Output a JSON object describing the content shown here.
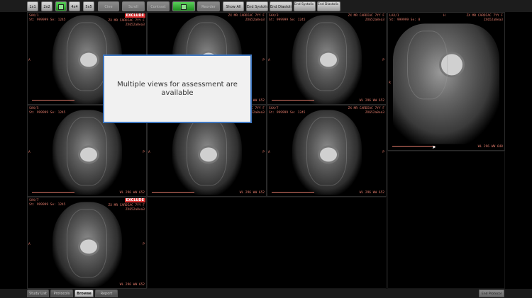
{
  "toolbar": {
    "buttons": [
      {
        "label": "1x1",
        "state": "normal"
      },
      {
        "label": "2x2",
        "state": "normal"
      },
      {
        "label": "",
        "state": "green"
      },
      {
        "label": "4x4",
        "state": "normal"
      },
      {
        "label": "5x5",
        "state": "normal"
      },
      {
        "label": "Cine",
        "state": "dim"
      },
      {
        "label": "Scroll",
        "state": "dim"
      },
      {
        "label": "Contrast",
        "state": "dim"
      },
      {
        "label": "",
        "state": "green"
      },
      {
        "label": "Reorder",
        "state": "dim"
      },
      {
        "label": "Show All",
        "state": "normal"
      },
      {
        "label": "End Systolic",
        "state": "normal"
      },
      {
        "label": "End Diastolic",
        "state": "normal"
      },
      {
        "label": "End Systolic (RV)",
        "state": "normal"
      },
      {
        "label": "End Diastolic (RV)",
        "state": "normal"
      }
    ]
  },
  "viewports": [
    {
      "series": "SAX/1",
      "study": "St: 999999 Se: 1245",
      "header": "ZX MR CARDIAC 7YY F",
      "id": "ZX652a8ea3",
      "excluded": true,
      "exclude_label": "EXCLUDE",
      "wl": "WL 296 WW 652",
      "left": "A",
      "right": "P"
    },
    {
      "series": "SAX/3",
      "study": "St: 999999 Se: 1245",
      "header": "ZX MR CARDIAC 7YY F",
      "id": "ZX652a8ea3",
      "excluded": false,
      "exclude_label": "",
      "wl": "WL 296 WW 652",
      "left": "A",
      "right": "P"
    },
    {
      "series": "SAX/3",
      "study": "St: 999999 Se: 1245",
      "header": "ZX MR CARDIAC 7YY F",
      "id": "ZX652a8ea3",
      "excluded": false,
      "exclude_label": "",
      "wl": "WL 296 WW 652",
      "left": "A",
      "right": "P"
    },
    {
      "series": "SAX/5",
      "study": "St: 999999 Se: 1245",
      "header": "ZX MR CARDIAC 7YY F",
      "id": "ZX652a8ea3",
      "excluded": false,
      "exclude_label": "",
      "wl": "WL 296 WW 652",
      "left": "A",
      "right": "P"
    },
    {
      "series": "SAX/6",
      "study": "St: 999999 Se: 1245",
      "header": "ZX MR CARDIAC 7YY F",
      "id": "ZX652a8ea3",
      "excluded": false,
      "exclude_label": "",
      "wl": "WL 296 WW 652",
      "left": "A",
      "right": "P"
    },
    {
      "series": "SAX/7",
      "study": "St: 999999 Se: 1245",
      "header": "ZX MR CARDIAC 7YY F",
      "id": "ZX652a8ea3",
      "excluded": false,
      "exclude_label": "",
      "wl": "WL 296 WW 652",
      "left": "A",
      "right": "P"
    },
    {
      "series": "SAX/7",
      "study": "St: 999999 Se: 1245",
      "header": "ZX MR CARDIAC 7YY F",
      "id": "ZX652a8ea3",
      "excluded": true,
      "exclude_label": "EXCLUDE",
      "wl": "WL 296 WW 652",
      "left": "A",
      "right": "P"
    }
  ],
  "large_view": {
    "series": "LAX/1",
    "study": "St: 999999 Se: 8",
    "header": "ZX MR CARDIAC 7YY F",
    "id": "ZX652a8ea3",
    "wl": "WL 296 WW 648",
    "top_right": "H",
    "left": "R"
  },
  "popup": {
    "message": "Multiple views for assessment are available"
  },
  "bottom_tabs": [
    {
      "label": "Study List",
      "active": false
    },
    {
      "label": "Protocols",
      "active": false
    },
    {
      "label": "Browse",
      "active": true
    },
    {
      "label": "Report",
      "active": false
    }
  ],
  "end_protocol_label": "End Protocol",
  "colors": {
    "overlay": "#e07a6a",
    "exclude": "#dd3333",
    "popup_border": "#3f77c0"
  }
}
